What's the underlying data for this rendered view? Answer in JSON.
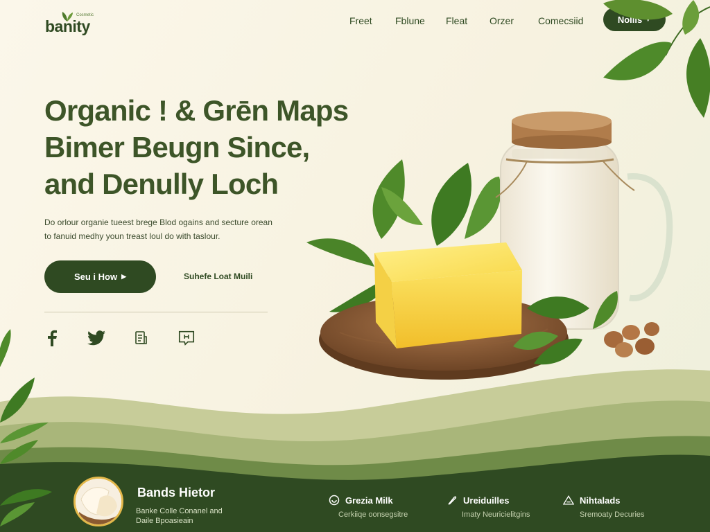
{
  "brand": {
    "logo_text": "banity",
    "logo_sub": "Cosmetic"
  },
  "nav": {
    "links": [
      "Freet",
      "Fblune",
      "Fleat",
      "Orzer",
      "Comecsiid"
    ],
    "button_label": "Nolils"
  },
  "hero": {
    "headline_lines": [
      "Organic ! & Grēn Maps",
      "Bimer Beugn Since,",
      "and Denully Loch"
    ],
    "lead_lines": [
      "Do orlour organie tueest brege Blod ogains and secture orean",
      "to fanuid medhy youn treast loul do with taslour."
    ],
    "cta_primary": "Seu i How",
    "cta_secondary": "Suhefe Loat Muili"
  },
  "social": {
    "icons": [
      "facebook-icon",
      "twitter-icon",
      "document-icon",
      "message-icon"
    ]
  },
  "footer_band": {
    "featured_title": "Bands Hietor",
    "featured_desc_lines": [
      "Banke Colle Conanel and",
      "Daile Bpoasieain"
    ],
    "features": [
      {
        "icon": "milk-icon",
        "title": "Grezia Milk",
        "subtitle": "Cerkiiqe oonsegsitre"
      },
      {
        "icon": "feather-icon",
        "title": "Ureiduilles",
        "subtitle": "Imaty Neuricielitgins"
      },
      {
        "icon": "triangle-icon",
        "title": "Nihtalads",
        "subtitle": "Sremoaty Decuries"
      }
    ]
  },
  "colors": {
    "primary": "#2f4a22",
    "background": "#fbf7ea",
    "band_dark": "#2f4a22",
    "band_light": "#a9b67a",
    "accent_gold": "#e4b84a"
  }
}
